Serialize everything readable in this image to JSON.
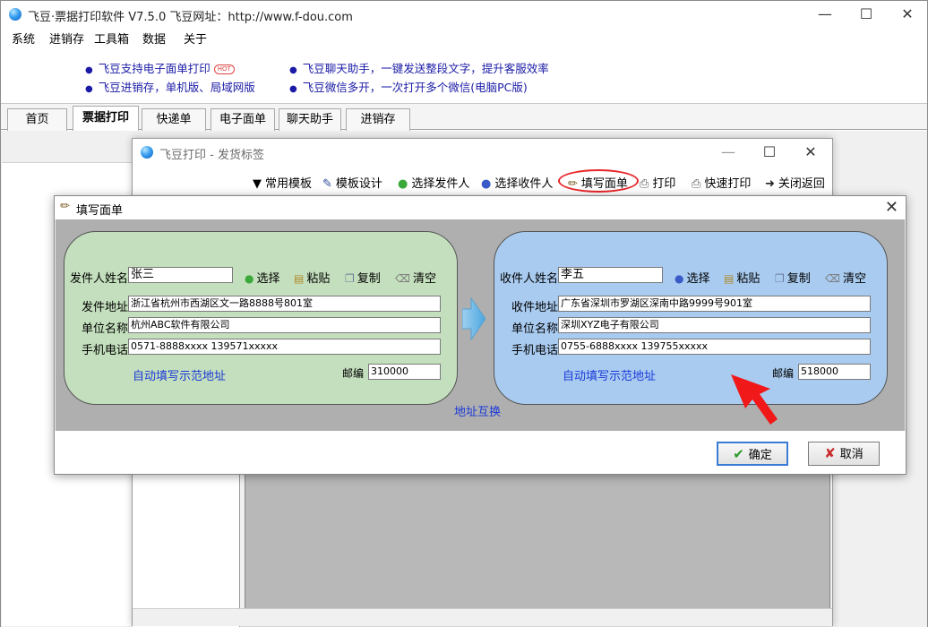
{
  "app": {
    "title": "飞豆·票据打印软件 V7.5.0   飞豆网址：http://www.f-dou.com",
    "menu": [
      "系统",
      "进销存",
      "工具箱",
      "数据",
      "关于"
    ],
    "promo_left": [
      "飞豆支持电子面单打印",
      "飞豆进销存，单机版、局域网版"
    ],
    "promo_right": [
      "飞豆聊天助手，一键发送整段文字，提升客服效率",
      "飞豆微信多开，一次打开多个微信(电脑PC版)"
    ],
    "hot_badge": "HOT",
    "tabs": [
      "首页",
      "票据打印",
      "快递单",
      "电子面单",
      "聊天助手",
      "进销存"
    ],
    "active_tab": "票据打印"
  },
  "ship_window": {
    "title": "飞豆打印 - 发货标签",
    "toolbar": [
      "常用模板",
      "模板设计",
      "选择发件人",
      "选择收件人",
      "填写面单",
      "打印",
      "快速打印",
      "关闭返回"
    ],
    "highlighted_button": "填写面单"
  },
  "dialog": {
    "title": "填写面单",
    "sender": {
      "name_label": "发件人姓名",
      "name": "张三",
      "address_label": "发件地址",
      "address": "浙江省杭州市西湖区文一路8888号801室",
      "company_label": "单位名称",
      "company": "杭州ABC软件有限公司",
      "phone_label": "手机电话",
      "phone": "0571-8888xxxx 139571xxxxx",
      "postcode_label": "邮编",
      "postcode": "310000",
      "auto_fill": "自动填写示范地址"
    },
    "receiver": {
      "name_label": "收件人姓名",
      "name": "李五",
      "address_label": "收件地址",
      "address": "广东省深圳市罗湖区深南中路9999号901室",
      "company_label": "单位名称",
      "company": "深圳XYZ电子有限公司",
      "phone_label": "手机电话",
      "phone": "0755-6888xxxx 139755xxxxx",
      "postcode_label": "邮编",
      "postcode": "518000",
      "auto_fill": "自动填写示范地址"
    },
    "actions": [
      "选择",
      "粘贴",
      "复制",
      "清空"
    ],
    "swap": "地址互换",
    "ok": "确定",
    "cancel": "取消"
  },
  "colors": {
    "sender_panel": "#c4dfbd",
    "receiver_panel": "#a9cbf0",
    "link": "#1a3ad8",
    "highlight": "#e8262a"
  }
}
